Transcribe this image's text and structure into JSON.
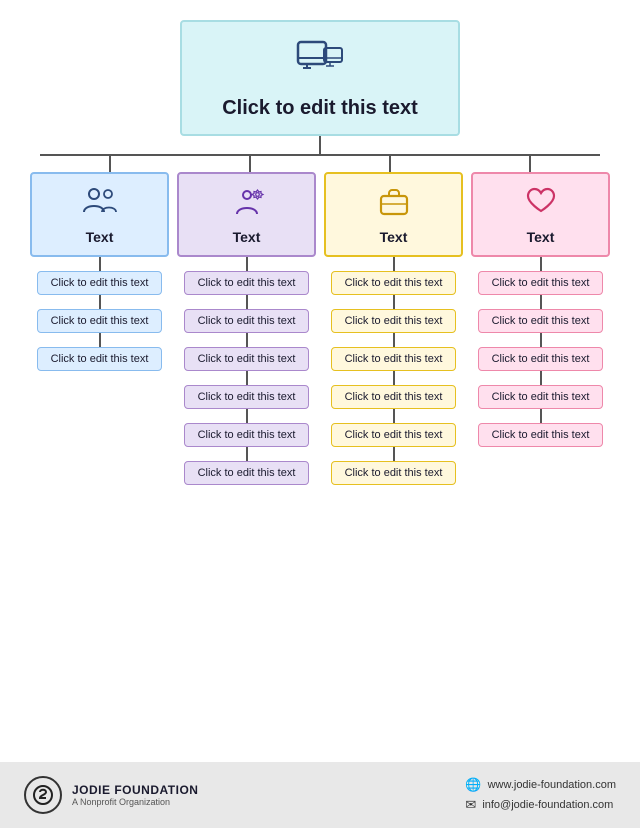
{
  "root": {
    "title": "Click to edit this text",
    "icon": "🖥"
  },
  "columns": [
    {
      "id": "col1",
      "color": "blue",
      "icon": "👥",
      "label": "Text",
      "children": [
        "Click to edit this text",
        "Click to edit this text",
        "Click to edit this text"
      ]
    },
    {
      "id": "col2",
      "color": "purple",
      "icon": "⚙",
      "label": "Text",
      "children": [
        "Click to edit this text",
        "Click to edit this text",
        "Click to edit this text",
        "Click to edit this text",
        "Click to edit this text",
        "Click to edit this text"
      ]
    },
    {
      "id": "col3",
      "color": "yellow",
      "icon": "💼",
      "label": "Text",
      "children": [
        "Click to edit this text",
        "Click to edit this text",
        "Click to edit this text",
        "Click to edit this text",
        "Click to edit this text",
        "Click to edit this text"
      ]
    },
    {
      "id": "col4",
      "color": "pink",
      "icon": "🤍",
      "label": "Text",
      "children": [
        "Click to edit this text",
        "Click to edit this text",
        "Click to edit this text",
        "Click to edit this text",
        "Click to edit this text"
      ]
    }
  ],
  "footer": {
    "org_name": "JODIE FOUNDATION",
    "org_sub": "A Nonprofit Organization",
    "website": "www.jodie-foundation.com",
    "email": "info@jodie-foundation.com"
  }
}
